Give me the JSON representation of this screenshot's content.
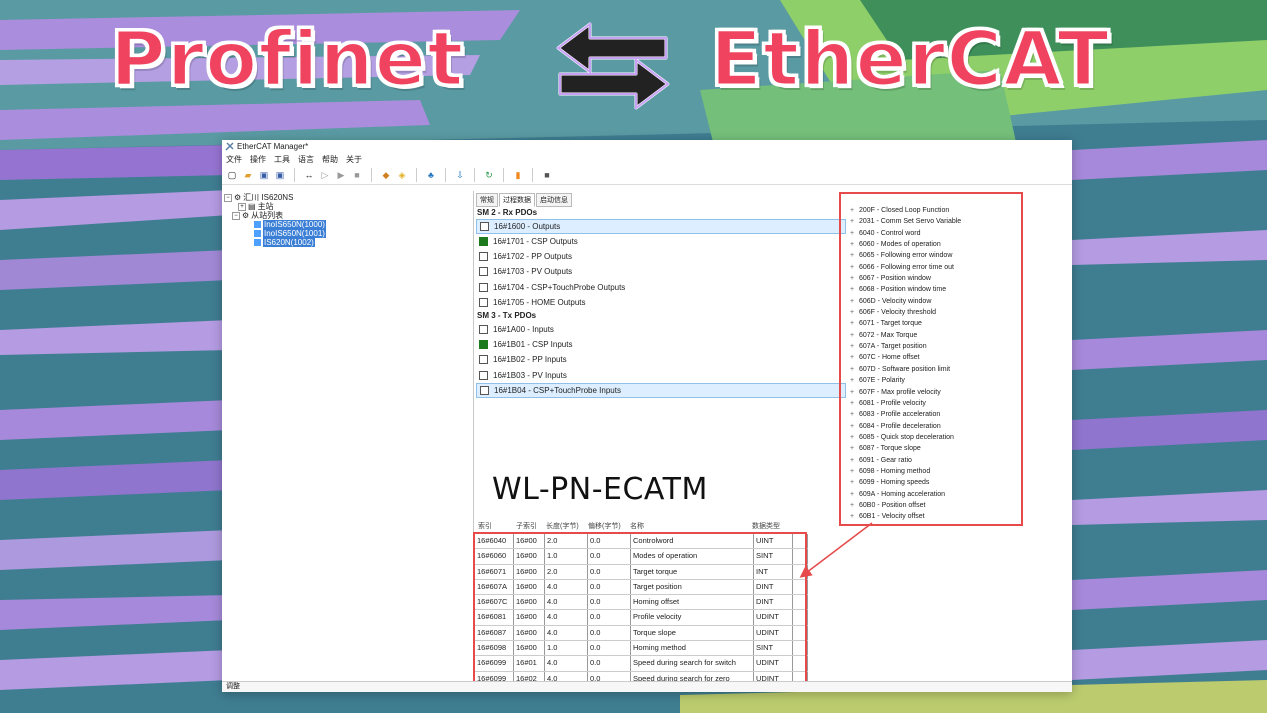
{
  "headline": {
    "left": "Profinet",
    "right": "EtherCAT",
    "arrows_icon": "bidirectional-arrows-icon"
  },
  "window": {
    "title": "EtherCAT Manager*",
    "menu": [
      "文件",
      "操作",
      "工具",
      "语言",
      "帮助",
      "关于"
    ],
    "status": "调整"
  },
  "tree": {
    "root": "汇川 IS620NS",
    "master": "主站",
    "slave_list": "从站列表",
    "devices": [
      "InoIS650N(1000)",
      "InoIS650N(1001)",
      "IS620N(1002)"
    ]
  },
  "tabs": [
    "常规",
    "过程数据",
    "启动信息"
  ],
  "sm2": {
    "title": "SM 2 - Rx PDOs",
    "items": [
      {
        "label": "16#1600  -  Outputs",
        "checked": false,
        "selected": true
      },
      {
        "label": "16#1701  -  CSP Outputs",
        "checked": true,
        "selected": false
      },
      {
        "label": "16#1702  -  PP Outputs",
        "checked": false,
        "selected": false
      },
      {
        "label": "16#1703  -  PV Outputs",
        "checked": false,
        "selected": false
      },
      {
        "label": "16#1704  -  CSP+TouchProbe Outputs",
        "checked": false,
        "selected": false
      },
      {
        "label": "16#1705  -  HOME Outputs",
        "checked": false,
        "selected": false
      }
    ]
  },
  "sm3": {
    "title": "SM 3 - Tx PDOs",
    "items": [
      {
        "label": "16#1A00  -  Inputs",
        "checked": false,
        "selected": false
      },
      {
        "label": "16#1B01  -  CSP Inputs",
        "checked": true,
        "selected": false
      },
      {
        "label": "16#1B02  -  PP Inputs",
        "checked": false,
        "selected": false
      },
      {
        "label": "16#1B03  -  PV Inputs",
        "checked": false,
        "selected": false
      },
      {
        "label": "16#1B04  -  CSP+TouchProbe Inputs",
        "checked": false,
        "selected": true
      }
    ]
  },
  "objects": [
    "200F - Closed Loop Function",
    "2031 - Comm Set Servo Variable",
    "6040 - Control word",
    "6060 - Modes of operation",
    "6065 - Following error window",
    "6066 - Following error time out",
    "6067 - Position window",
    "6068 - Position window time",
    "606D - Velocity window",
    "606F - Velocity threshold",
    "6071 - Target torque",
    "6072 - Max Torque",
    "607A - Target position",
    "607C - Home offset",
    "607D - Software position limit",
    "607E - Polarity",
    "607F - Max profile velocity",
    "6081 - Profile velocity",
    "6083 - Profile acceleration",
    "6084 - Profile deceleration",
    "6085 - Quick stop deceleration",
    "6087 - Torque slope",
    "6091 - Gear ratio",
    "6098 - Homing method",
    "6099 - Homing speeds",
    "609A - Homing acceleration",
    "60B0 - Position offset",
    "60B1 - Velocity offset"
  ],
  "brand": "WL-PN-ECATM",
  "table": {
    "headers": [
      "索引",
      "子索引",
      "长度(字节)",
      "偏移(字节)",
      "名称",
      "数据类型"
    ],
    "rows": [
      [
        "16#6040",
        "16#00",
        "2.0",
        "0.0",
        "Controlword",
        "UINT"
      ],
      [
        "16#6060",
        "16#00",
        "1.0",
        "0.0",
        "Modes of operation",
        "SINT"
      ],
      [
        "16#6071",
        "16#00",
        "2.0",
        "0.0",
        "Target torque",
        "INT"
      ],
      [
        "16#607A",
        "16#00",
        "4.0",
        "0.0",
        "Target position",
        "DINT"
      ],
      [
        "16#607C",
        "16#00",
        "4.0",
        "0.0",
        "Homing offset",
        "DINT"
      ],
      [
        "16#6081",
        "16#00",
        "4.0",
        "0.0",
        "Profile velocity",
        "UDINT"
      ],
      [
        "16#6087",
        "16#00",
        "4.0",
        "0.0",
        "Torque slope",
        "UDINT"
      ],
      [
        "16#6098",
        "16#00",
        "1.0",
        "0.0",
        "Homing method",
        "SINT"
      ],
      [
        "16#6099",
        "16#01",
        "4.0",
        "0.0",
        "Speed during search for switch",
        "UDINT"
      ],
      [
        "16#6099",
        "16#02",
        "4.0",
        "0.0",
        "Speed during search for zero",
        "UDINT"
      ]
    ]
  },
  "colors": {
    "headline": "#f0435f",
    "highlight_box": "#e64a4a",
    "checked": "#1c7a1c",
    "selection": "#dceeff"
  }
}
